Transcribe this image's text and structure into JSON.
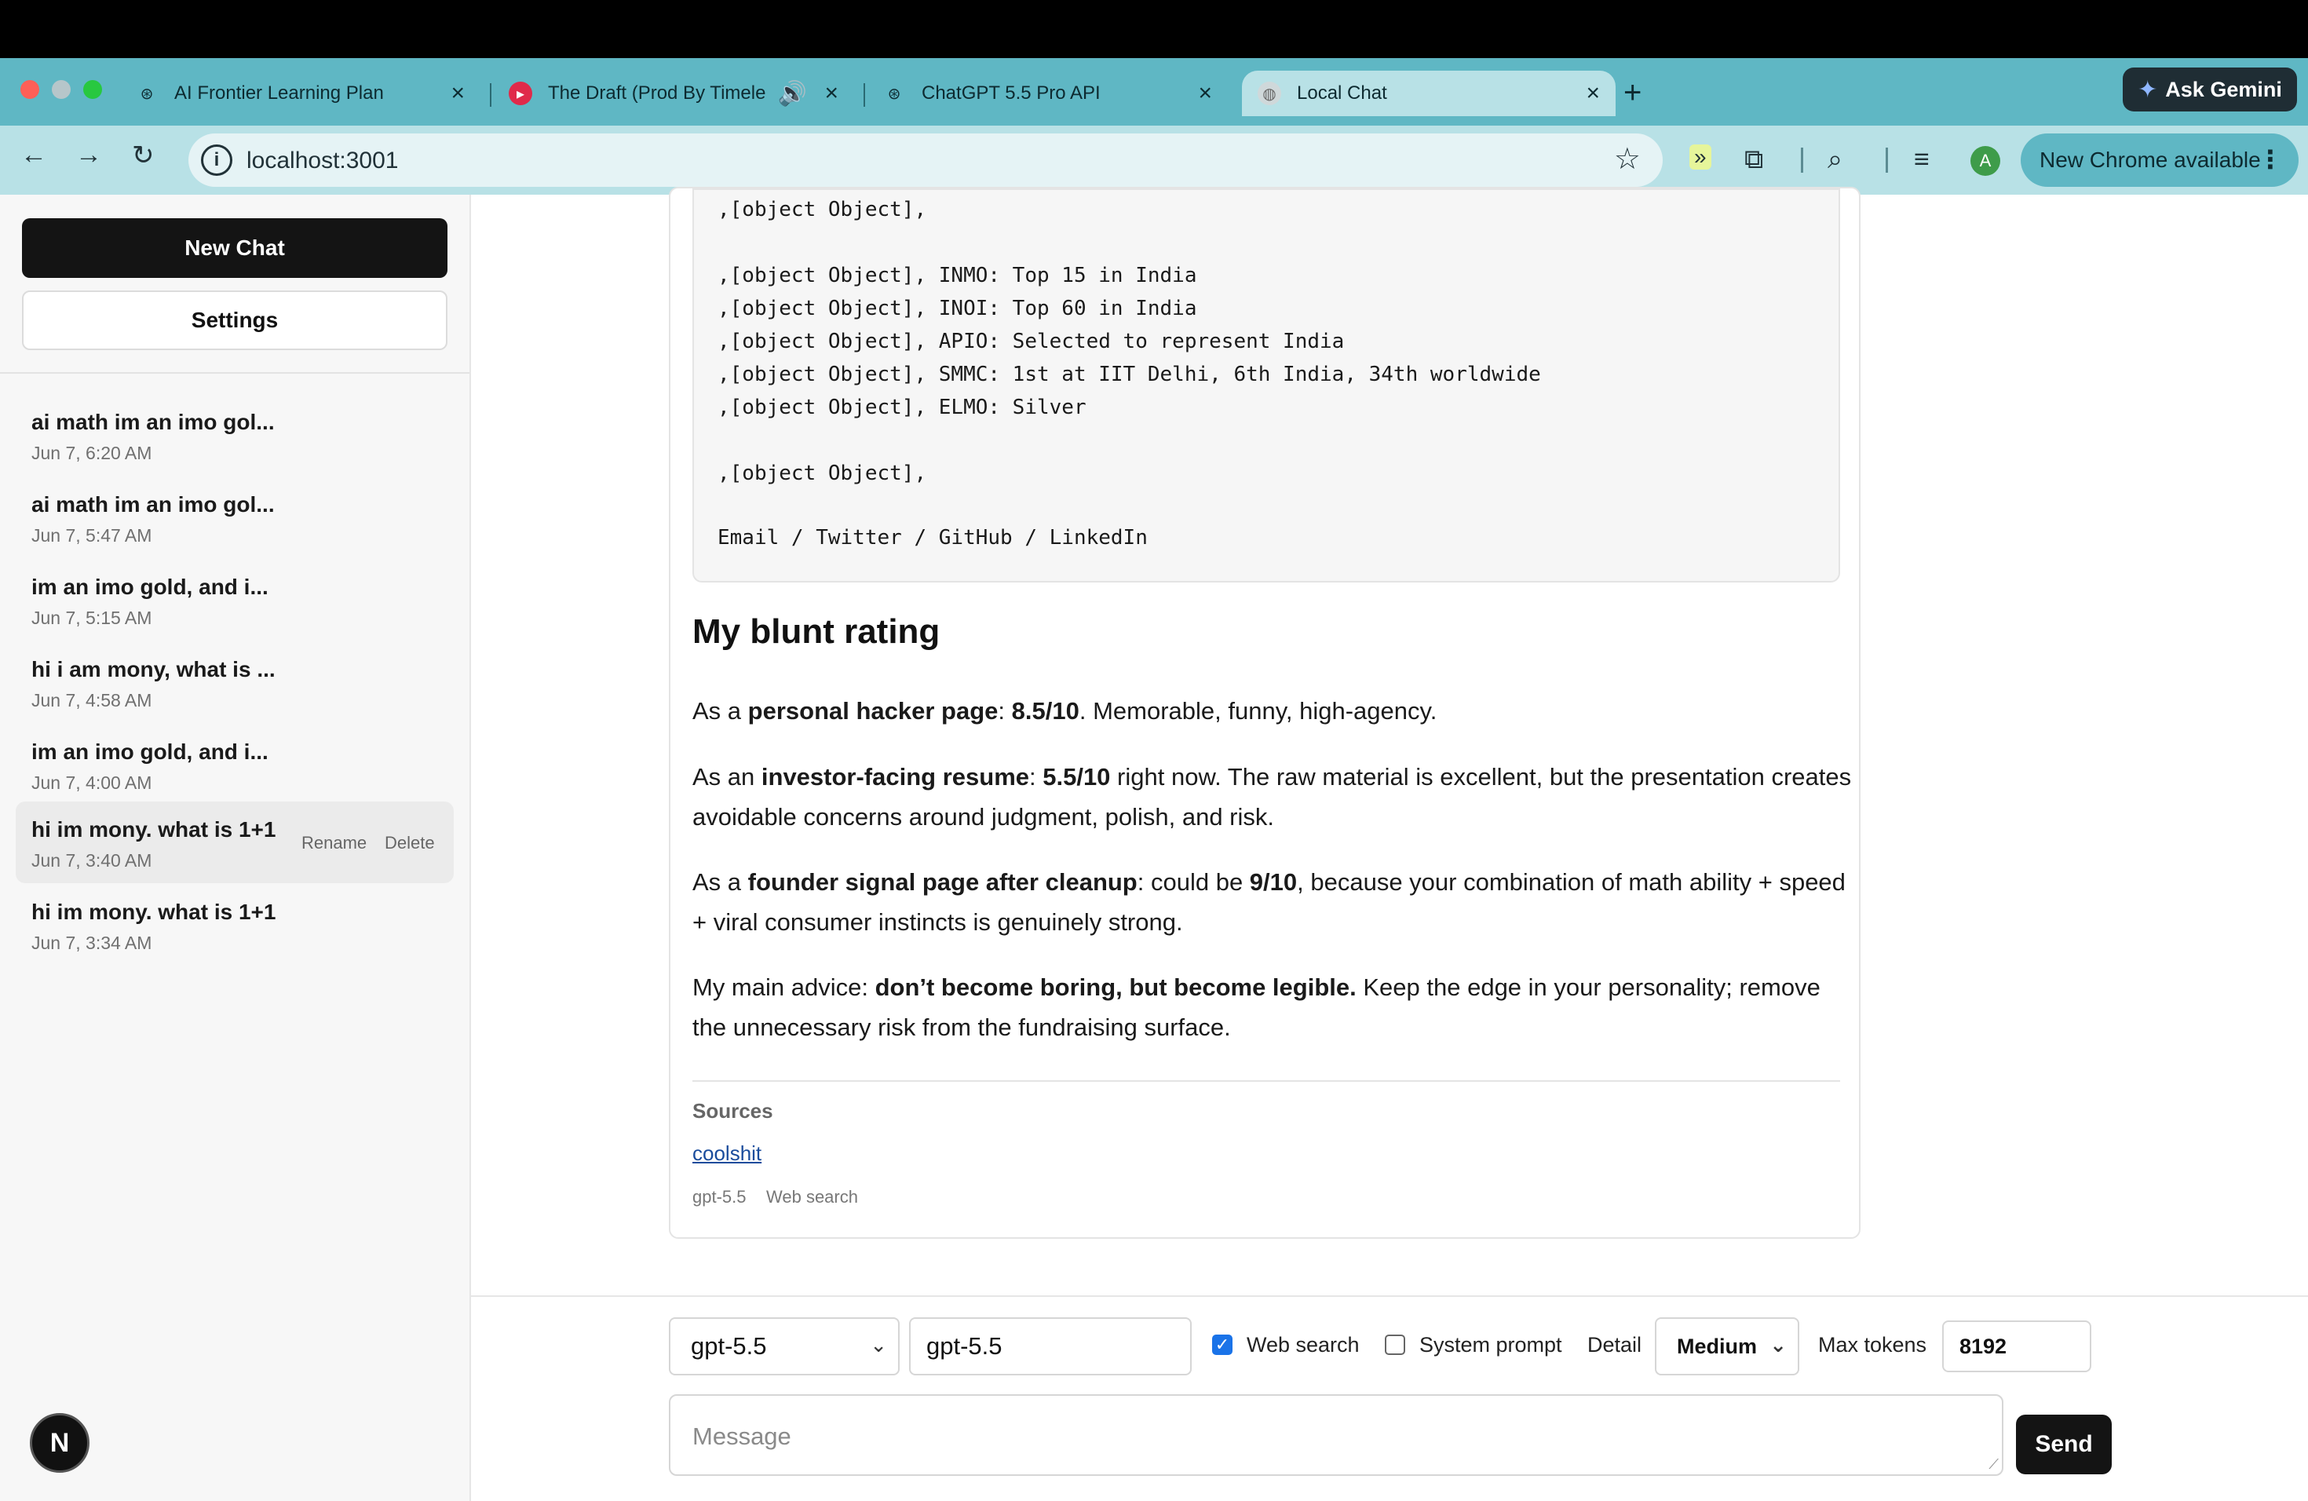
{
  "browser": {
    "tabs": [
      {
        "title": "AI Frontier Learning Plan"
      },
      {
        "title": "The Draft (Prod By Timele"
      },
      {
        "title": "ChatGPT 5.5 Pro API"
      },
      {
        "title": "Local Chat"
      }
    ],
    "new_tab_icon": "+",
    "gemini_label": "Ask Gemini",
    "url": "localhost:3001",
    "update_label": "New Chrome available",
    "profile_initial": "A"
  },
  "sidebar": {
    "new_chat": "New Chat",
    "settings": "Settings",
    "chats": [
      {
        "title": "ai math im an imo gol...",
        "date": "Jun 7, 6:20 AM"
      },
      {
        "title": "ai math im an imo gol...",
        "date": "Jun 7, 5:47 AM"
      },
      {
        "title": "im an imo gold, and i...",
        "date": "Jun 7, 5:15 AM"
      },
      {
        "title": "hi i am mony, what is ...",
        "date": "Jun 7, 4:58 AM"
      },
      {
        "title": "im an imo gold, and i...",
        "date": "Jun 7, 4:00 AM"
      },
      {
        "title": "hi im mony. what is 1+1",
        "date": "Jun 7, 3:40 AM",
        "rename": "Rename",
        "delete": "Delete"
      },
      {
        "title": "hi im mony. what is 1+1",
        "date": "Jun 7, 3:34 AM"
      }
    ],
    "badge": "N"
  },
  "message": {
    "code_lines": [
      ",[object Object],",
      "",
      ",[object Object], INMO: Top 15 in India",
      ",[object Object], INOI: Top 60 in India",
      ",[object Object], APIO: Selected to represent India",
      ",[object Object], SMMC: 1st at IIT Delhi, 6th India, 34th worldwide",
      ",[object Object], ELMO: Silver",
      "",
      ",[object Object],",
      "",
      "Email / Twitter / GitHub / LinkedIn"
    ],
    "heading": "My blunt rating",
    "p1": {
      "pre": "As a ",
      "b1": "personal hacker page",
      "mid": ": ",
      "b2": "8.5/10",
      "post": ". Memorable, funny, high-agency."
    },
    "p2": {
      "pre": "As an ",
      "b1": "investor-facing resume",
      "mid": ": ",
      "b2": "5.5/10",
      "post": " right now. The raw material is excellent, but the presentation creates avoidable concerns around judgment, polish, and risk."
    },
    "p3": {
      "pre": "As a ",
      "b1": "founder signal page after cleanup",
      "mid": ": could be ",
      "b2": "9/10",
      "post": ", because your combination of math ability + speed + viral consumer instincts is genuinely strong."
    },
    "p4": {
      "pre": "My main advice: ",
      "b1": "don’t become boring, but become legible.",
      "post": " Keep the edge in your personality; remove the unnecessary risk from the fundraising surface."
    },
    "sources_label": "Sources",
    "source_link": "coolshit",
    "meta_model": "gpt-5.5",
    "meta_tool": "Web search"
  },
  "composer": {
    "model_select": "gpt-5.5",
    "model_input": "gpt-5.5",
    "web_search_label": "Web search",
    "web_search_checked": true,
    "system_prompt_label": "System prompt",
    "system_prompt_checked": false,
    "detail_label": "Detail",
    "detail_value": "Medium",
    "max_tokens_label": "Max tokens",
    "max_tokens_value": "8192",
    "message_placeholder": "Message",
    "send_label": "Send"
  }
}
